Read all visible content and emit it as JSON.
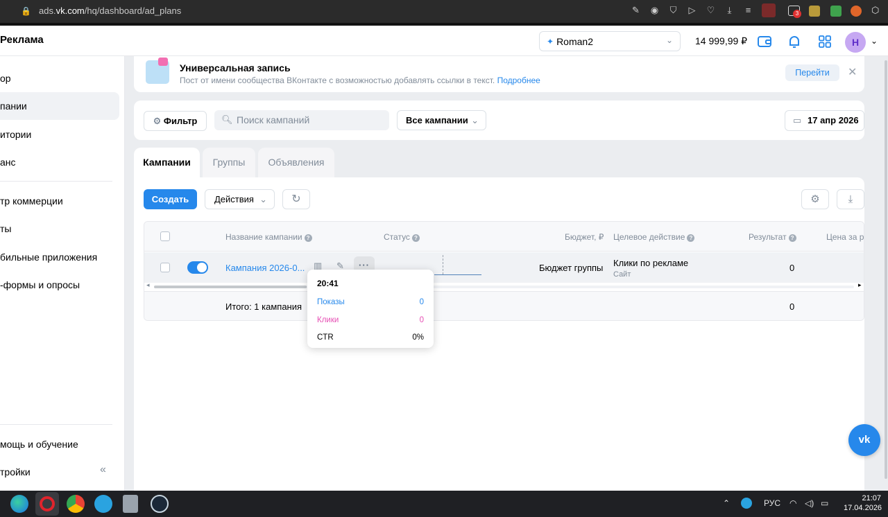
{
  "browser": {
    "url_prefix": "ads.",
    "url_domain": "vk.com",
    "url_path": "/hq/dashboard/ad_plans",
    "badge_count": "3"
  },
  "header": {
    "brand": "Реклама",
    "account": "Roman2",
    "balance": "14 999,99 ₽",
    "avatar_letter": "Н"
  },
  "sidebar": {
    "items": [
      {
        "label": "ор"
      },
      {
        "label": "пании"
      },
      {
        "label": "итории"
      },
      {
        "label": "анс"
      },
      {
        "label": "тр коммерции"
      },
      {
        "label": "ты"
      },
      {
        "label": "бильные приложения"
      },
      {
        "label": "-формы и опросы"
      }
    ],
    "bottom_items": [
      {
        "label": "мощь и обучение"
      },
      {
        "label": "тройки"
      }
    ]
  },
  "banner": {
    "title": "Универсальная запись",
    "text": "Пост от имени сообщества ВКонтакте с возможностью добавлять ссылки в текст.",
    "link": "Подробнее",
    "button": "Перейти"
  },
  "filters": {
    "filter_label": "Фильтр",
    "search_placeholder": "Поиск кампаний",
    "campaign_select": "Все кампании",
    "date": "17 апр 2026"
  },
  "tabs": [
    {
      "label": "Кампании"
    },
    {
      "label": "Группы"
    },
    {
      "label": "Объявления"
    }
  ],
  "toolbar": {
    "create": "Создать",
    "actions": "Действия"
  },
  "table": {
    "headers": {
      "name": "Название кампании",
      "status": "Статус",
      "budget": "Бюджет, ₽",
      "goal": "Целевое действие",
      "result": "Результат",
      "price": "Цена за ре"
    },
    "rows": [
      {
        "name": "Кампания 2026-0...",
        "budget": "Бюджет группы",
        "goal": "Клики по рекламе",
        "goal_sub": "Сайт",
        "result": "0"
      }
    ],
    "total_label": "Итого: 1 кампания",
    "total_result": "0"
  },
  "tooltip": {
    "time": "20:41",
    "rows": [
      {
        "label": "Показы",
        "value": "0",
        "color": "#2688eb"
      },
      {
        "label": "Клики",
        "value": "0",
        "color": "#e64fb4"
      },
      {
        "label": "CTR",
        "value": "0%",
        "color": "#000000"
      }
    ]
  },
  "taskbar": {
    "lang": "РУС",
    "time": "21:07",
    "date": "17.04.2026"
  },
  "colors": {
    "accent": "#2688eb",
    "clicks": "#e64fb4"
  }
}
